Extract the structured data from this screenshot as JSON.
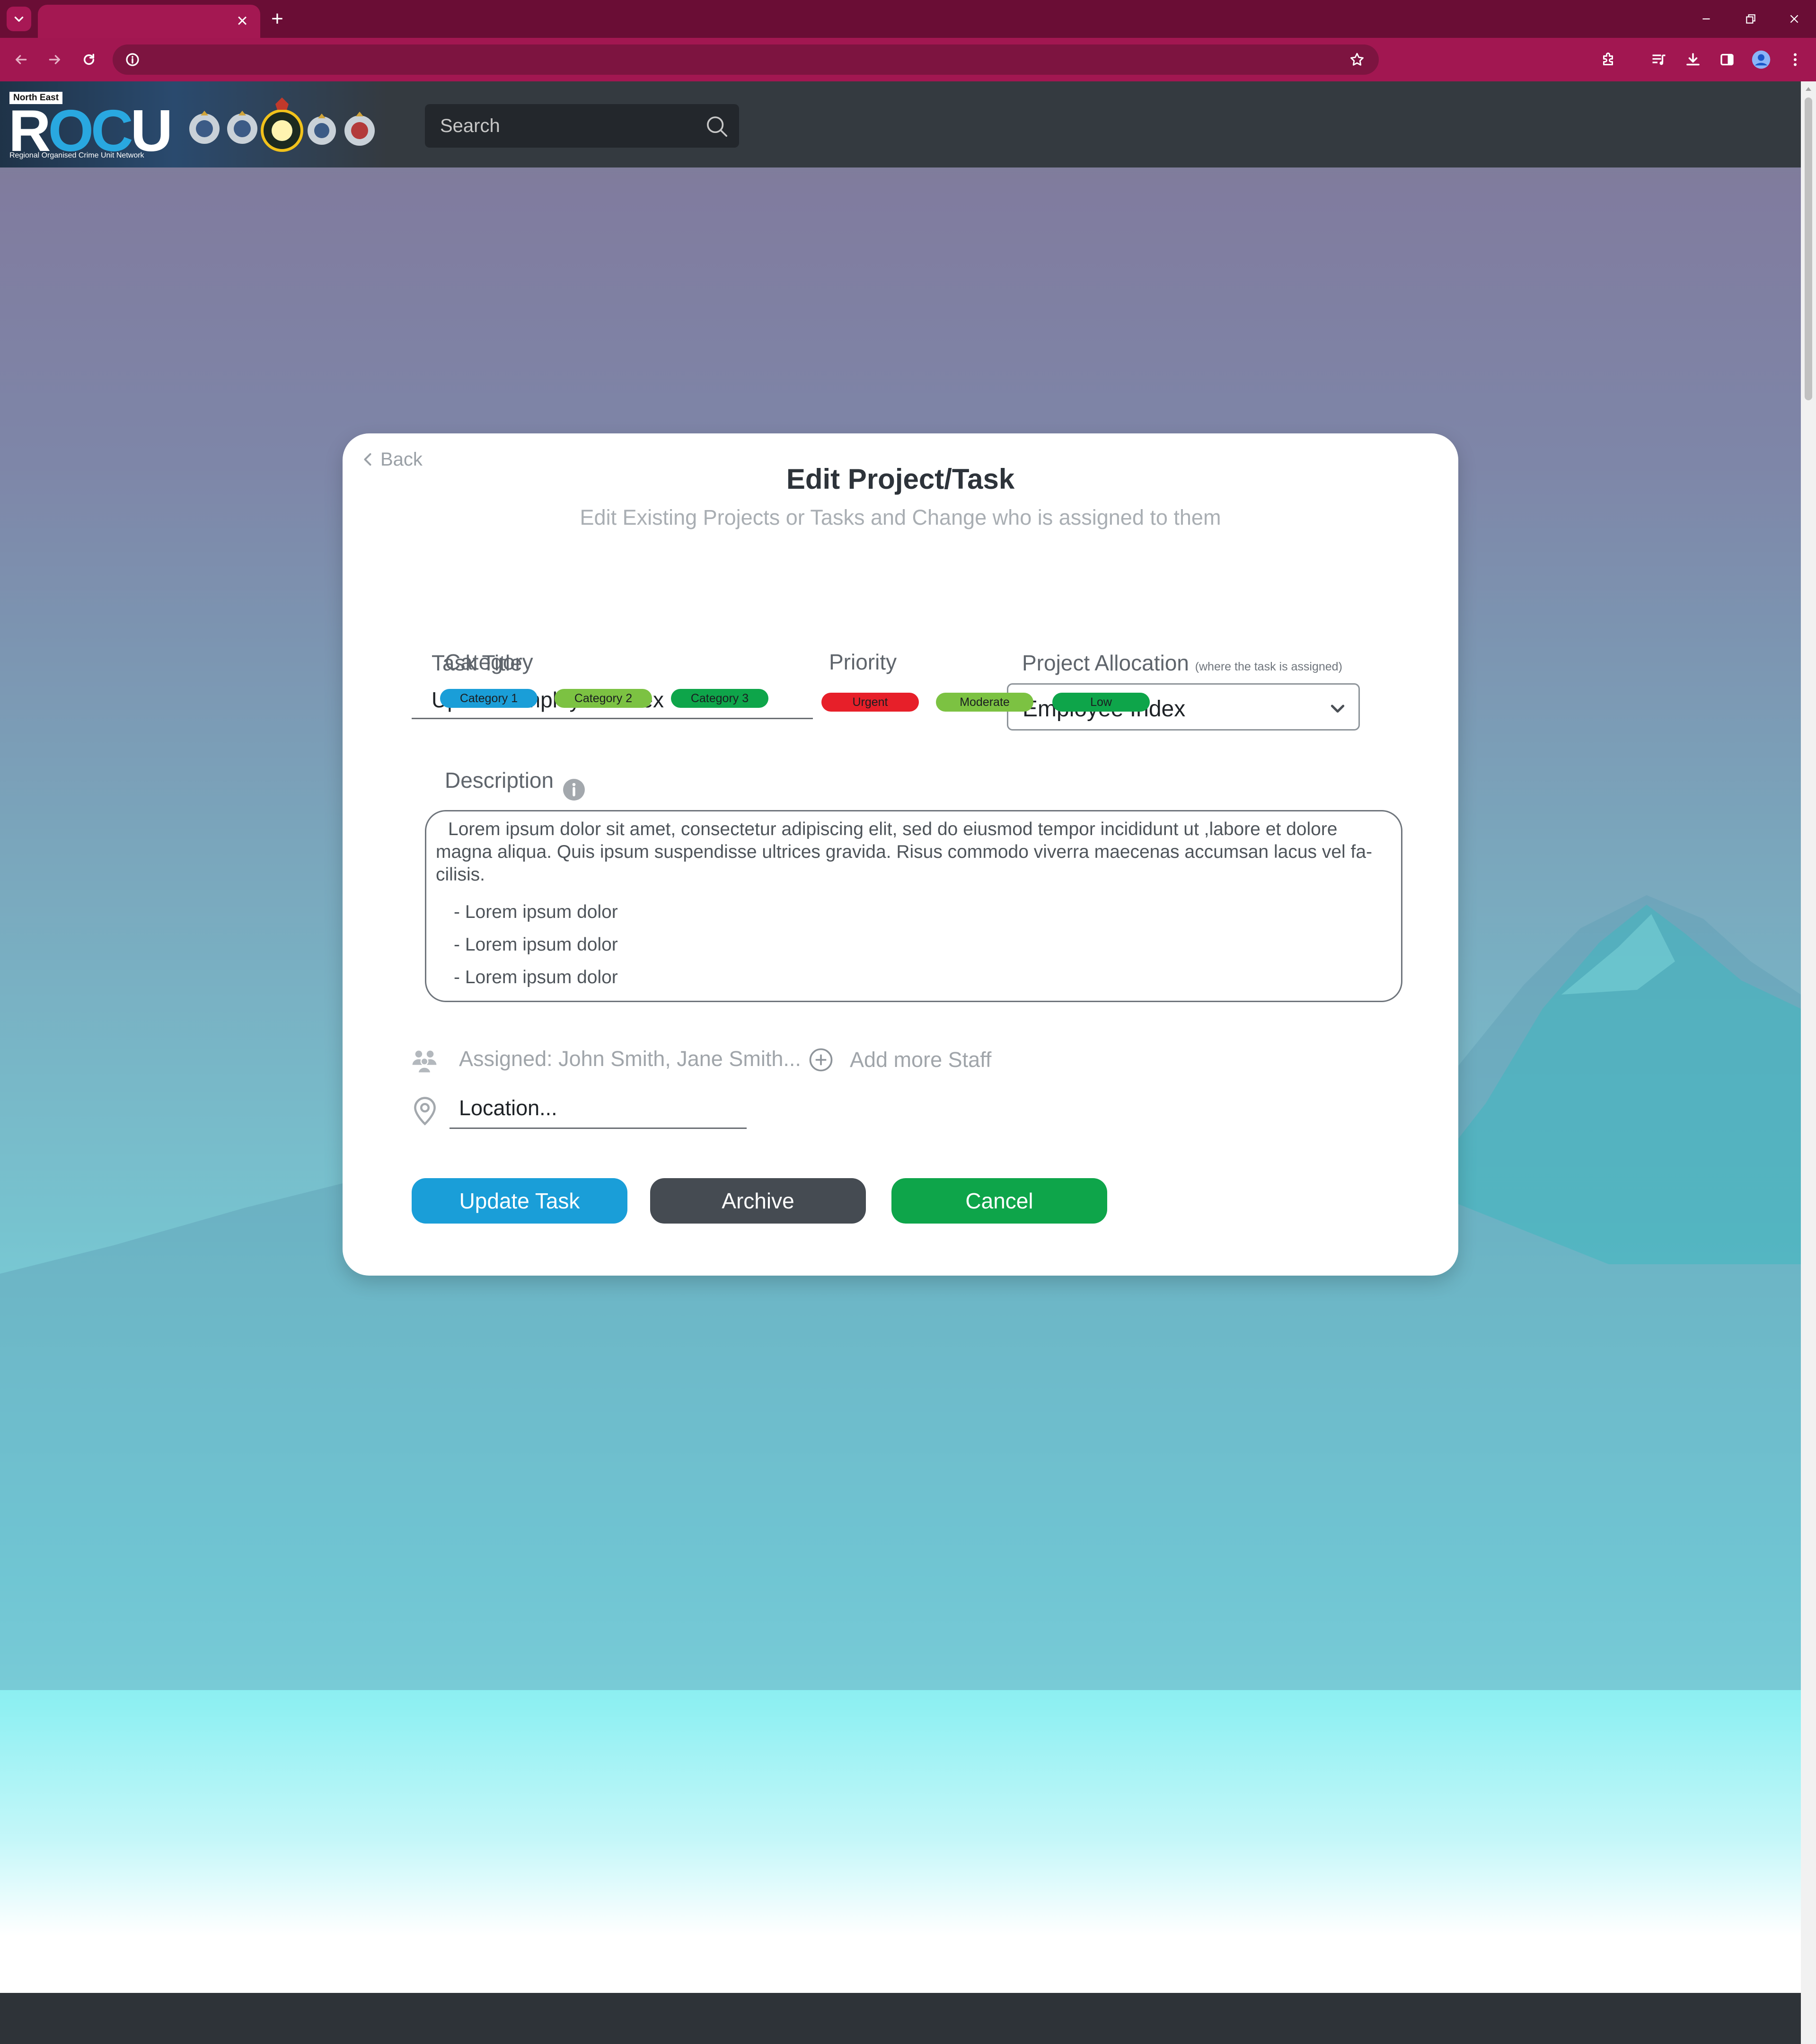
{
  "browser": {
    "accent": "#a21751",
    "tab_close_symbol": "×",
    "new_tab_symbol": "+"
  },
  "header": {
    "logo": {
      "region": "North East",
      "letters_pre": "R",
      "letters_o": "O",
      "letters_c": "C",
      "letters_post": "U",
      "tagline": "Regional Organised Crime Unit Network"
    },
    "search": {
      "placeholder": "Search"
    }
  },
  "modal": {
    "back_label": "Back",
    "title": "Edit Project/Task",
    "subtitle": "Edit Existing Projects or Tasks and Change who is assigned to them",
    "task_title": {
      "label": "Task Title",
      "value": "Update Employee Index"
    },
    "project_allocation": {
      "label": "Project Allocation",
      "hint": "(where the task is assigned)",
      "value": "Employee Index"
    },
    "category": {
      "label": "Category",
      "options": [
        {
          "label": "Category 1",
          "color": "#1a9ed8"
        },
        {
          "label": "Category 2",
          "color": "#7cc242"
        },
        {
          "label": "Category 3",
          "color": "#0ea54a"
        }
      ]
    },
    "priority": {
      "label": "Priority",
      "options": [
        {
          "label": "Urgent",
          "color": "#e71f29"
        },
        {
          "label": "Moderate",
          "color": "#7cc242"
        },
        {
          "label": "Low",
          "color": "#0ea54a"
        }
      ]
    },
    "description": {
      "label": "Description",
      "paragraph": "Lorem ipsum dolor sit amet, consectetur adipiscing elit, sed do eiusmod tempor incididunt ut ,labore et dolore magna aliqua. Quis ipsum suspendisse ultrices gravida. Risus commodo viverra maecenas accumsan lacus vel fa-cilisis.",
      "items": [
        "- Lorem ipsum dolor",
        "- Lorem ipsum dolor",
        "- Lorem ipsum dolor"
      ]
    },
    "assigned_text": "Assigned: John Smith, Jane Smith...",
    "add_staff_label": "Add more Staff",
    "location": {
      "placeholder": "Location..."
    },
    "buttons": {
      "update": {
        "label": "Update Task",
        "color": "#1a9ed8"
      },
      "archive": {
        "label": "Archive",
        "color": "#454b52"
      },
      "cancel": {
        "label": "Cancel",
        "color": "#0ea54a"
      }
    }
  }
}
